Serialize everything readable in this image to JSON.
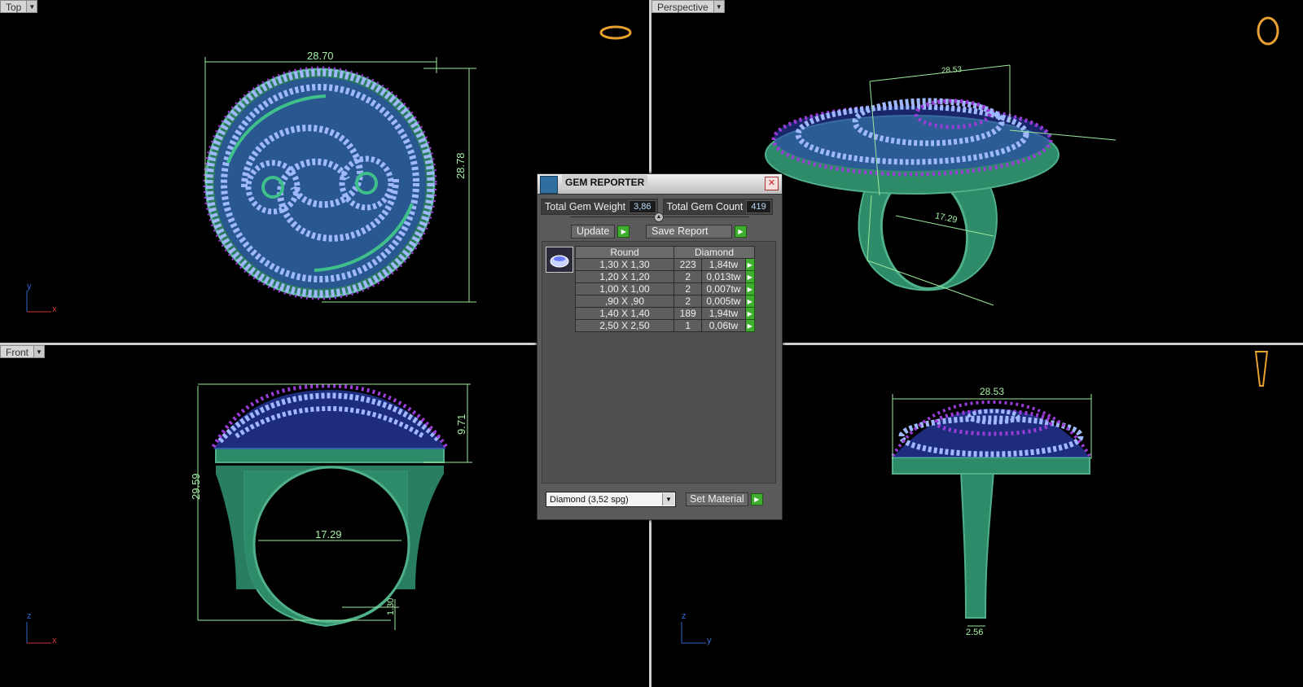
{
  "viewports": {
    "top": {
      "label": "Top"
    },
    "persp": {
      "label": "Perspective"
    },
    "front": {
      "label": "Front"
    },
    "right": {
      "label": ""
    }
  },
  "dimensions": {
    "top_width": "28.70",
    "top_height": "28.78",
    "persp_width": "28.53",
    "persp_inner": "17.29",
    "persp_depth": "9.71",
    "persp_band": "1.30",
    "persp_band2": "2.56",
    "front_height": "29.59",
    "front_top": "9.71",
    "front_inner": "17.29",
    "front_band": "1.30",
    "right_width": "28.53",
    "right_band": "2.56"
  },
  "axes": {
    "x": "x",
    "y": "y",
    "z": "z"
  },
  "gem_reporter": {
    "title": "GEM REPORTER",
    "close": "✕",
    "total_weight_label": "Total Gem Weight",
    "total_weight": "3,86",
    "total_count_label": "Total Gem Count",
    "total_count": "419",
    "update_label": "Update",
    "save_label": "Save Report",
    "col_shape": "Round",
    "col_material": "Diamond",
    "rows": [
      {
        "size": "1,30 X 1,30",
        "count": "223",
        "weight": "1,84tw"
      },
      {
        "size": "1,20 X 1,20",
        "count": "2",
        "weight": "0,013tw"
      },
      {
        "size": "1,00 X 1,00",
        "count": "2",
        "weight": "0,007tw"
      },
      {
        "size": ",90 X ,90",
        "count": "2",
        "weight": "0,005tw"
      },
      {
        "size": "1,40 X 1,40",
        "count": "189",
        "weight": "1,94tw"
      },
      {
        "size": "2,50 X 2,50",
        "count": "1",
        "weight": "0,06tw"
      }
    ],
    "material_select": "Diamond    (3,52 spg)",
    "set_material_label": "Set Material"
  },
  "colors": {
    "green": "#2e8b6a",
    "gem_light": "#8fb0ff",
    "gem_purple": "#9a3cd8",
    "dimension": "#9be89b"
  }
}
